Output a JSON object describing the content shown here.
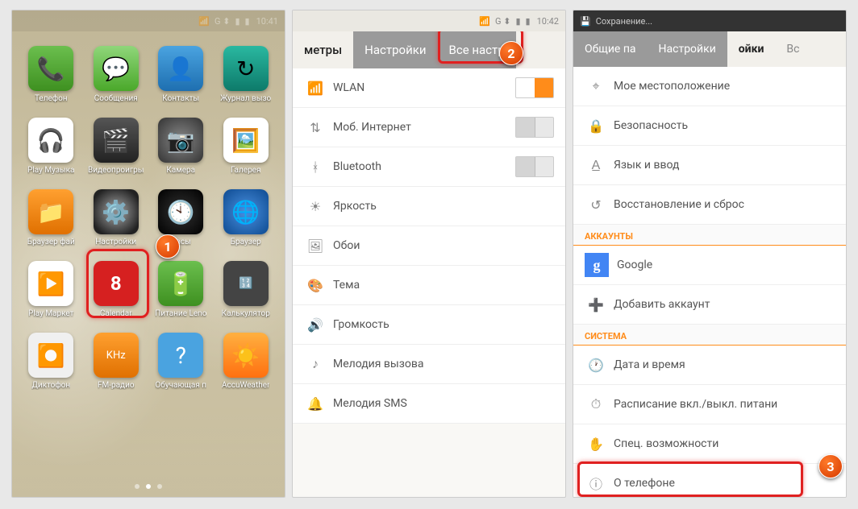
{
  "screen1": {
    "status_time": "10:41",
    "badge": "1",
    "apps": {
      "r1c1": "Телефон",
      "r1c2": "Сообщения",
      "r1c3": "Контакты",
      "r1c4": "Журнал вызо",
      "r2c1": "Play Музыка",
      "r2c2": "Видеопроигры",
      "r2c3": "Камера",
      "r2c4": "Галерея",
      "r3c1": "Браузер фай",
      "r3c2": "Настройки",
      "r3c3": "Часы",
      "r3c4": "Браузер",
      "r4c1": "Play Маркет",
      "r4c2": "Calendar",
      "r4c3": "Питание Leno",
      "r4c4": "Калькулятор",
      "r5c1": "Диктофон",
      "r5c2": "FM-радио",
      "r5c3": "Обучающая п",
      "r5c4": "AccuWeather"
    }
  },
  "screen2": {
    "status_time": "10:42",
    "badge": "2",
    "tabs": {
      "t1": "метры",
      "t2": "Настройки",
      "t3": "Все настр"
    },
    "rows": {
      "wlan": "WLAN",
      "mobile": "Моб. Интернет",
      "bt": "Bluetooth",
      "brightness": "Яркость",
      "wallpaper": "Обои",
      "theme": "Тема",
      "volume": "Громкость",
      "ringtone": "Мелодия вызова",
      "sms": "Мелодия SMS"
    }
  },
  "screen3": {
    "header": "Сохранение...",
    "badge": "3",
    "tabs": {
      "t1": "Общие па",
      "t2": "Настройки",
      "t3": "ойки",
      "t4": "Вс"
    },
    "rows": {
      "location": "Мое местоположение",
      "security": "Безопасность",
      "lang": "Язык и ввод",
      "reset": "Восстановление и сброс",
      "google": "Google",
      "add_account": "Добавить аккаунт",
      "datetime": "Дата и время",
      "schedule": "Расписание вкл./выкл. питани",
      "accessibility": "Спец. возможности",
      "about": "О телефоне"
    },
    "sections": {
      "accounts": "АККАУНТЫ",
      "system": "СИСТЕМА"
    }
  }
}
